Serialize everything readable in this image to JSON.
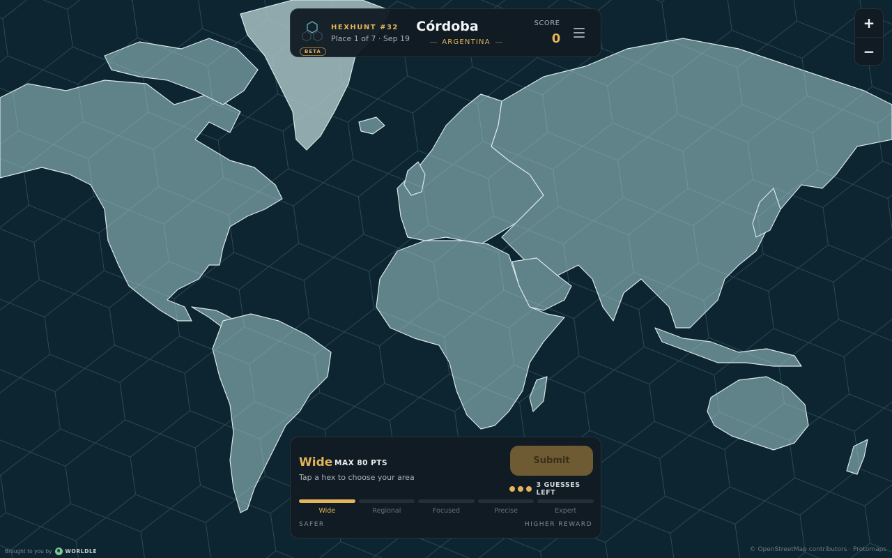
{
  "header": {
    "game_name": "HEXHUNT #32",
    "subtitle": "Place 1 of 7 · Sep 19",
    "badge": "BETA",
    "city": "Córdoba",
    "country": "ARGENTINA",
    "score_label": "SCORE",
    "score_value": "0"
  },
  "zoom": {
    "in_label": "+",
    "out_label": "−"
  },
  "panel": {
    "mode_title": "Wide",
    "mode_max": "MAX 80 PTS",
    "hint": "Tap a hex to choose your area",
    "submit_label": "Submit",
    "guesses_remaining": 3,
    "guesses_text": "3 GUESSES LEFT",
    "levels": [
      "Wide",
      "Regional",
      "Focused",
      "Precise",
      "Expert"
    ],
    "active_level": "Wide",
    "scale_left": "SAFER",
    "scale_right": "HIGHER REWARD"
  },
  "footer": {
    "credit_prefix": "Brought to you by",
    "credit_brand": "WORLDLE",
    "attribution": "© OpenStreetMap contributors · Protomaps"
  },
  "colors": {
    "ocean": "#0c2530",
    "land": "#5f8388",
    "accent": "#e4b458",
    "panel": "#111b23"
  }
}
